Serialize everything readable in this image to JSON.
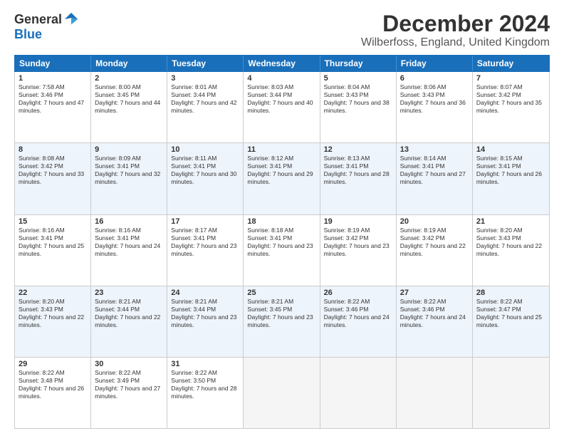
{
  "logo": {
    "general": "General",
    "blue": "Blue"
  },
  "title": "December 2024",
  "location": "Wilberfoss, England, United Kingdom",
  "header_days": [
    "Sunday",
    "Monday",
    "Tuesday",
    "Wednesday",
    "Thursday",
    "Friday",
    "Saturday"
  ],
  "weeks": [
    [
      {
        "day": "1",
        "sunrise": "Sunrise: 7:58 AM",
        "sunset": "Sunset: 3:46 PM",
        "daylight": "Daylight: 7 hours and 47 minutes."
      },
      {
        "day": "2",
        "sunrise": "Sunrise: 8:00 AM",
        "sunset": "Sunset: 3:45 PM",
        "daylight": "Daylight: 7 hours and 44 minutes."
      },
      {
        "day": "3",
        "sunrise": "Sunrise: 8:01 AM",
        "sunset": "Sunset: 3:44 PM",
        "daylight": "Daylight: 7 hours and 42 minutes."
      },
      {
        "day": "4",
        "sunrise": "Sunrise: 8:03 AM",
        "sunset": "Sunset: 3:44 PM",
        "daylight": "Daylight: 7 hours and 40 minutes."
      },
      {
        "day": "5",
        "sunrise": "Sunrise: 8:04 AM",
        "sunset": "Sunset: 3:43 PM",
        "daylight": "Daylight: 7 hours and 38 minutes."
      },
      {
        "day": "6",
        "sunrise": "Sunrise: 8:06 AM",
        "sunset": "Sunset: 3:43 PM",
        "daylight": "Daylight: 7 hours and 36 minutes."
      },
      {
        "day": "7",
        "sunrise": "Sunrise: 8:07 AM",
        "sunset": "Sunset: 3:42 PM",
        "daylight": "Daylight: 7 hours and 35 minutes."
      }
    ],
    [
      {
        "day": "8",
        "sunrise": "Sunrise: 8:08 AM",
        "sunset": "Sunset: 3:42 PM",
        "daylight": "Daylight: 7 hours and 33 minutes."
      },
      {
        "day": "9",
        "sunrise": "Sunrise: 8:09 AM",
        "sunset": "Sunset: 3:41 PM",
        "daylight": "Daylight: 7 hours and 32 minutes."
      },
      {
        "day": "10",
        "sunrise": "Sunrise: 8:11 AM",
        "sunset": "Sunset: 3:41 PM",
        "daylight": "Daylight: 7 hours and 30 minutes."
      },
      {
        "day": "11",
        "sunrise": "Sunrise: 8:12 AM",
        "sunset": "Sunset: 3:41 PM",
        "daylight": "Daylight: 7 hours and 29 minutes."
      },
      {
        "day": "12",
        "sunrise": "Sunrise: 8:13 AM",
        "sunset": "Sunset: 3:41 PM",
        "daylight": "Daylight: 7 hours and 28 minutes."
      },
      {
        "day": "13",
        "sunrise": "Sunrise: 8:14 AM",
        "sunset": "Sunset: 3:41 PM",
        "daylight": "Daylight: 7 hours and 27 minutes."
      },
      {
        "day": "14",
        "sunrise": "Sunrise: 8:15 AM",
        "sunset": "Sunset: 3:41 PM",
        "daylight": "Daylight: 7 hours and 26 minutes."
      }
    ],
    [
      {
        "day": "15",
        "sunrise": "Sunrise: 8:16 AM",
        "sunset": "Sunset: 3:41 PM",
        "daylight": "Daylight: 7 hours and 25 minutes."
      },
      {
        "day": "16",
        "sunrise": "Sunrise: 8:16 AM",
        "sunset": "Sunset: 3:41 PM",
        "daylight": "Daylight: 7 hours and 24 minutes."
      },
      {
        "day": "17",
        "sunrise": "Sunrise: 8:17 AM",
        "sunset": "Sunset: 3:41 PM",
        "daylight": "Daylight: 7 hours and 23 minutes."
      },
      {
        "day": "18",
        "sunrise": "Sunrise: 8:18 AM",
        "sunset": "Sunset: 3:41 PM",
        "daylight": "Daylight: 7 hours and 23 minutes."
      },
      {
        "day": "19",
        "sunrise": "Sunrise: 8:19 AM",
        "sunset": "Sunset: 3:42 PM",
        "daylight": "Daylight: 7 hours and 23 minutes."
      },
      {
        "day": "20",
        "sunrise": "Sunrise: 8:19 AM",
        "sunset": "Sunset: 3:42 PM",
        "daylight": "Daylight: 7 hours and 22 minutes."
      },
      {
        "day": "21",
        "sunrise": "Sunrise: 8:20 AM",
        "sunset": "Sunset: 3:43 PM",
        "daylight": "Daylight: 7 hours and 22 minutes."
      }
    ],
    [
      {
        "day": "22",
        "sunrise": "Sunrise: 8:20 AM",
        "sunset": "Sunset: 3:43 PM",
        "daylight": "Daylight: 7 hours and 22 minutes."
      },
      {
        "day": "23",
        "sunrise": "Sunrise: 8:21 AM",
        "sunset": "Sunset: 3:44 PM",
        "daylight": "Daylight: 7 hours and 22 minutes."
      },
      {
        "day": "24",
        "sunrise": "Sunrise: 8:21 AM",
        "sunset": "Sunset: 3:44 PM",
        "daylight": "Daylight: 7 hours and 23 minutes."
      },
      {
        "day": "25",
        "sunrise": "Sunrise: 8:21 AM",
        "sunset": "Sunset: 3:45 PM",
        "daylight": "Daylight: 7 hours and 23 minutes."
      },
      {
        "day": "26",
        "sunrise": "Sunrise: 8:22 AM",
        "sunset": "Sunset: 3:46 PM",
        "daylight": "Daylight: 7 hours and 24 minutes."
      },
      {
        "day": "27",
        "sunrise": "Sunrise: 8:22 AM",
        "sunset": "Sunset: 3:46 PM",
        "daylight": "Daylight: 7 hours and 24 minutes."
      },
      {
        "day": "28",
        "sunrise": "Sunrise: 8:22 AM",
        "sunset": "Sunset: 3:47 PM",
        "daylight": "Daylight: 7 hours and 25 minutes."
      }
    ],
    [
      {
        "day": "29",
        "sunrise": "Sunrise: 8:22 AM",
        "sunset": "Sunset: 3:48 PM",
        "daylight": "Daylight: 7 hours and 26 minutes."
      },
      {
        "day": "30",
        "sunrise": "Sunrise: 8:22 AM",
        "sunset": "Sunset: 3:49 PM",
        "daylight": "Daylight: 7 hours and 27 minutes."
      },
      {
        "day": "31",
        "sunrise": "Sunrise: 8:22 AM",
        "sunset": "Sunset: 3:50 PM",
        "daylight": "Daylight: 7 hours and 28 minutes."
      },
      null,
      null,
      null,
      null
    ]
  ]
}
